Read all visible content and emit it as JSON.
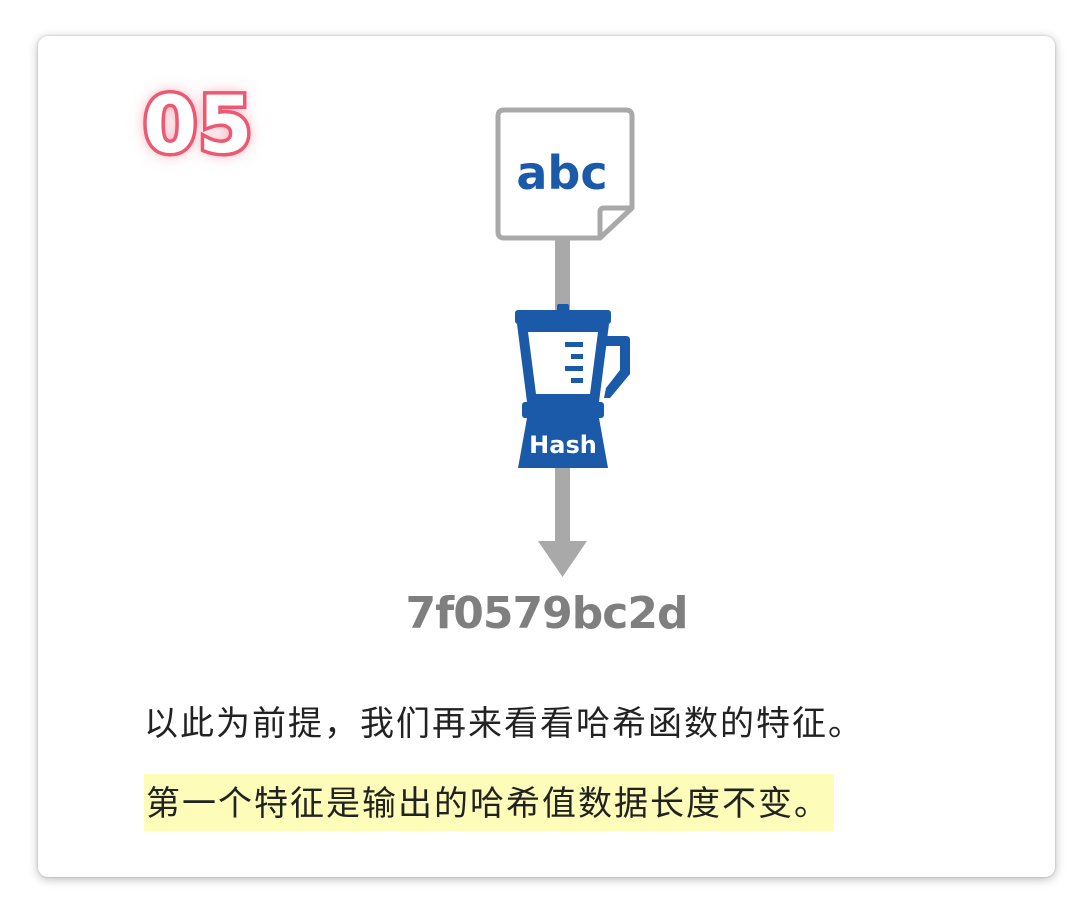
{
  "step_number": "05",
  "document_text": "abc",
  "hash_label": "Hash",
  "hash_output": "7f0579bc2d",
  "paragraph": {
    "line1": "以此为前提，我们再来看看哈希函数的特征。",
    "line2": "第一个特征是输出的哈希值数据长度不变。"
  },
  "colors": {
    "accent_pink": "#ee5a73",
    "blender_blue": "#1a5aa8",
    "arrow_gray": "#a9a9a9",
    "highlight_yellow": "#fdfcb8"
  },
  "icons": [
    "document-icon",
    "blender-icon",
    "down-arrow-icon"
  ]
}
